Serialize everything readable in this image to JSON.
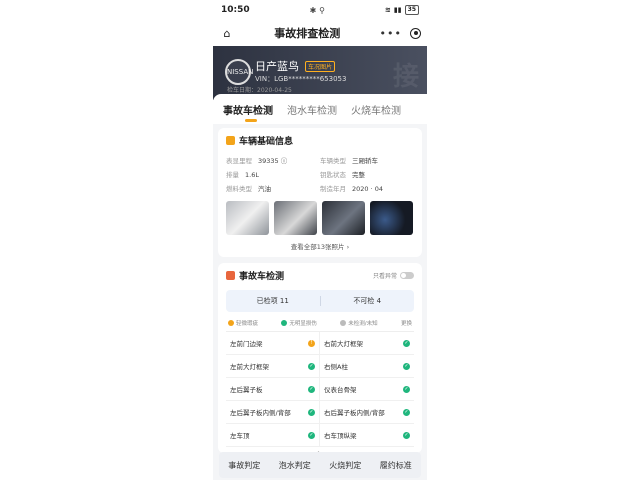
{
  "status": {
    "time": "10:50",
    "icons": "✱ ⚲",
    "battery": "35"
  },
  "nav": {
    "title": "事故排查检测",
    "home_icon": "⌂",
    "more": "•••"
  },
  "car": {
    "logo_text": "NISSAN",
    "name": "日产蓝鸟",
    "tag": "车况图片",
    "vin": "VIN：LGB*********653053",
    "date": "检车日期：2020-04-25",
    "watermark": "接"
  },
  "tabs": [
    {
      "label": "事故车检测",
      "active": true
    },
    {
      "label": "泡水车检测",
      "active": false
    },
    {
      "label": "火烧车检测",
      "active": false
    }
  ],
  "basic": {
    "title": "车辆基础信息",
    "fields": [
      {
        "k": "表显里程",
        "v": "39335 ⓘ"
      },
      {
        "k": "车辆类型",
        "v": "三厢轿车"
      },
      {
        "k": "排量",
        "v": "1.6L"
      },
      {
        "k": "钥匙状态",
        "v": "完整"
      },
      {
        "k": "燃料类型",
        "v": "汽油"
      },
      {
        "k": "制造年月",
        "v": "2020 · 04"
      }
    ],
    "view_all": "查看全部13张照片 ›"
  },
  "accident": {
    "title": "事故车检测",
    "toggle_label": "只看异常",
    "summary": [
      "已检项 11",
      "不可检 4"
    ],
    "legend": [
      "轻微瑕疵",
      "无明显损伤",
      "未检测/未知",
      "更换"
    ],
    "items": [
      {
        "name": "左前门边梁",
        "status": "warn",
        "more": "!"
      },
      {
        "name": "右前大灯框架",
        "status": "ok",
        "more": "✓"
      },
      {
        "name": "左前大灯框架",
        "status": "ok",
        "more": "✓"
      },
      {
        "name": "右侧A柱",
        "status": "ok",
        "more": "✓"
      },
      {
        "name": "左后翼子板",
        "status": "ok",
        "more": "✓"
      },
      {
        "name": "仪表台骨架",
        "status": "ok",
        "more": "✓"
      },
      {
        "name": "左后翼子板内侧/背部",
        "status": "ok",
        "more": "✓"
      },
      {
        "name": "右后翼子板内侧/背部",
        "status": "ok",
        "more": "✓"
      },
      {
        "name": "左车顶",
        "status": "ok",
        "more": "✓"
      },
      {
        "name": "右车顶纵梁",
        "status": "ok",
        "more": "✓"
      }
    ]
  },
  "bottom": [
    "事故判定",
    "泡水判定",
    "火烧判定",
    "履约标准"
  ],
  "colors": {
    "accent": "#f3a41a",
    "ok": "#1fb67d",
    "banner": "#2d3240"
  }
}
